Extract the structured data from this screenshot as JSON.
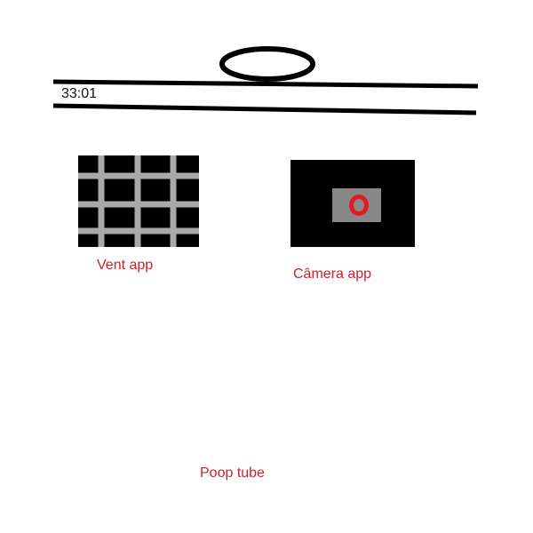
{
  "status_bar": {
    "clock": "33:01"
  },
  "apps": {
    "vent": {
      "label": "Vent app",
      "icon": "vent-grate-icon"
    },
    "camera": {
      "label": "Câmera app",
      "icon": "camera-icon"
    }
  },
  "bottom": {
    "poop_tube_label": "Poop tube"
  },
  "colors": {
    "label_text": "#c8232c",
    "lens": "#e11b22",
    "icon_background": "#000000",
    "grate": "#a9a9a9",
    "lens_box": "#888888"
  }
}
